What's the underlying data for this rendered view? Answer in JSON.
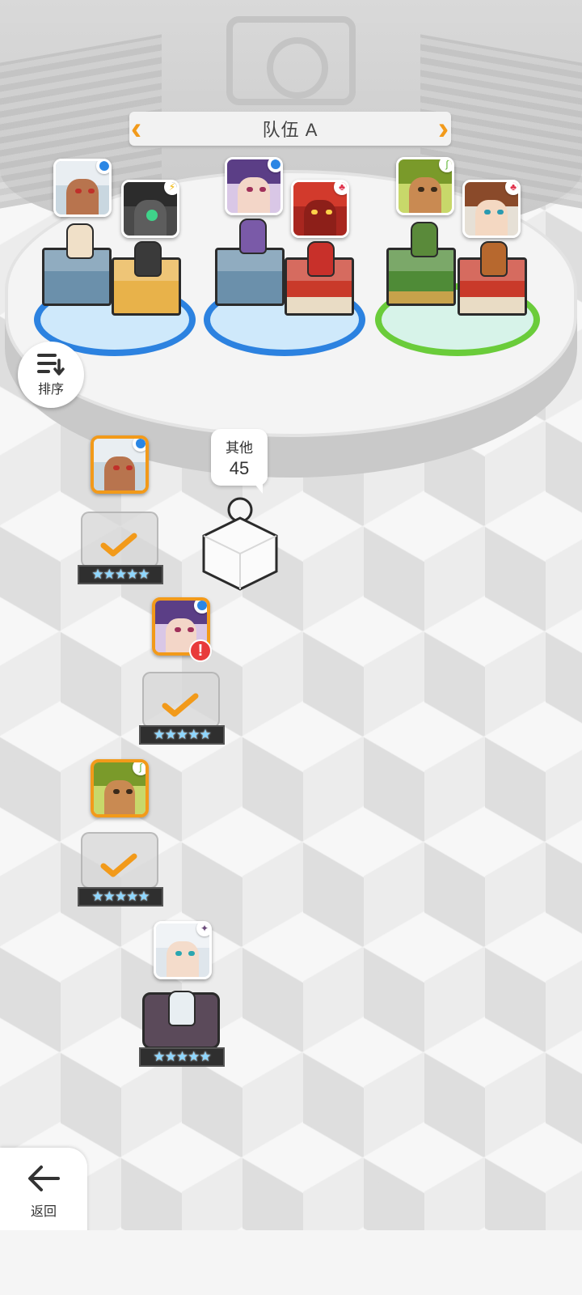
{
  "team_header": {
    "title": "队伍 A"
  },
  "colors": {
    "accent": "#f29a1a",
    "water": "#2a86e4",
    "fire": "#e0304a",
    "leaf": "#5bb52e",
    "light": "#f0b400"
  },
  "team_slots": [
    {
      "element": "water",
      "block": "water"
    },
    {
      "element": "light",
      "block": "gold"
    },
    {
      "element": "water",
      "block": "water"
    },
    {
      "element": "fire",
      "block": "fire"
    },
    {
      "element": "leaf",
      "block": "leaf"
    },
    {
      "element": "fire",
      "block": "fire"
    }
  ],
  "sort_button": {
    "label": "排序"
  },
  "other_bubble": {
    "label": "其他",
    "count": "45"
  },
  "hero_list": [
    {
      "element": "water",
      "selected": true,
      "checked": true,
      "stars": "★★★★★",
      "warning": false
    },
    {
      "element": "water",
      "selected": true,
      "checked": true,
      "stars": "★★★★★",
      "warning": true
    },
    {
      "element": "leaf",
      "selected": true,
      "checked": true,
      "stars": "★★★★★",
      "warning": false
    },
    {
      "element": "dark",
      "selected": false,
      "checked": false,
      "stars": "★★★★★",
      "warning": false
    }
  ],
  "warning_symbol": "!",
  "back_button": {
    "label": "返回"
  }
}
